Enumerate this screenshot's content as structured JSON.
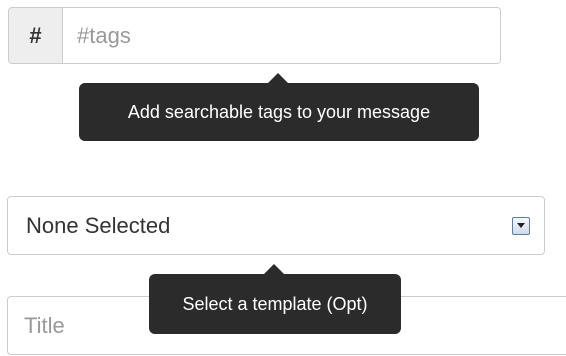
{
  "tags": {
    "addon_symbol": "#",
    "placeholder": "#tags",
    "value": "",
    "tooltip": "Add searchable tags to your message"
  },
  "template_select": {
    "selected": "None Selected",
    "tooltip": "Select a template (Opt)"
  },
  "title": {
    "placeholder": "Title",
    "value": ""
  },
  "colors": {
    "tooltip_bg": "#2b2b2b",
    "border": "#cccccc",
    "addon_bg": "#eeeeee",
    "placeholder_text": "#999999"
  }
}
